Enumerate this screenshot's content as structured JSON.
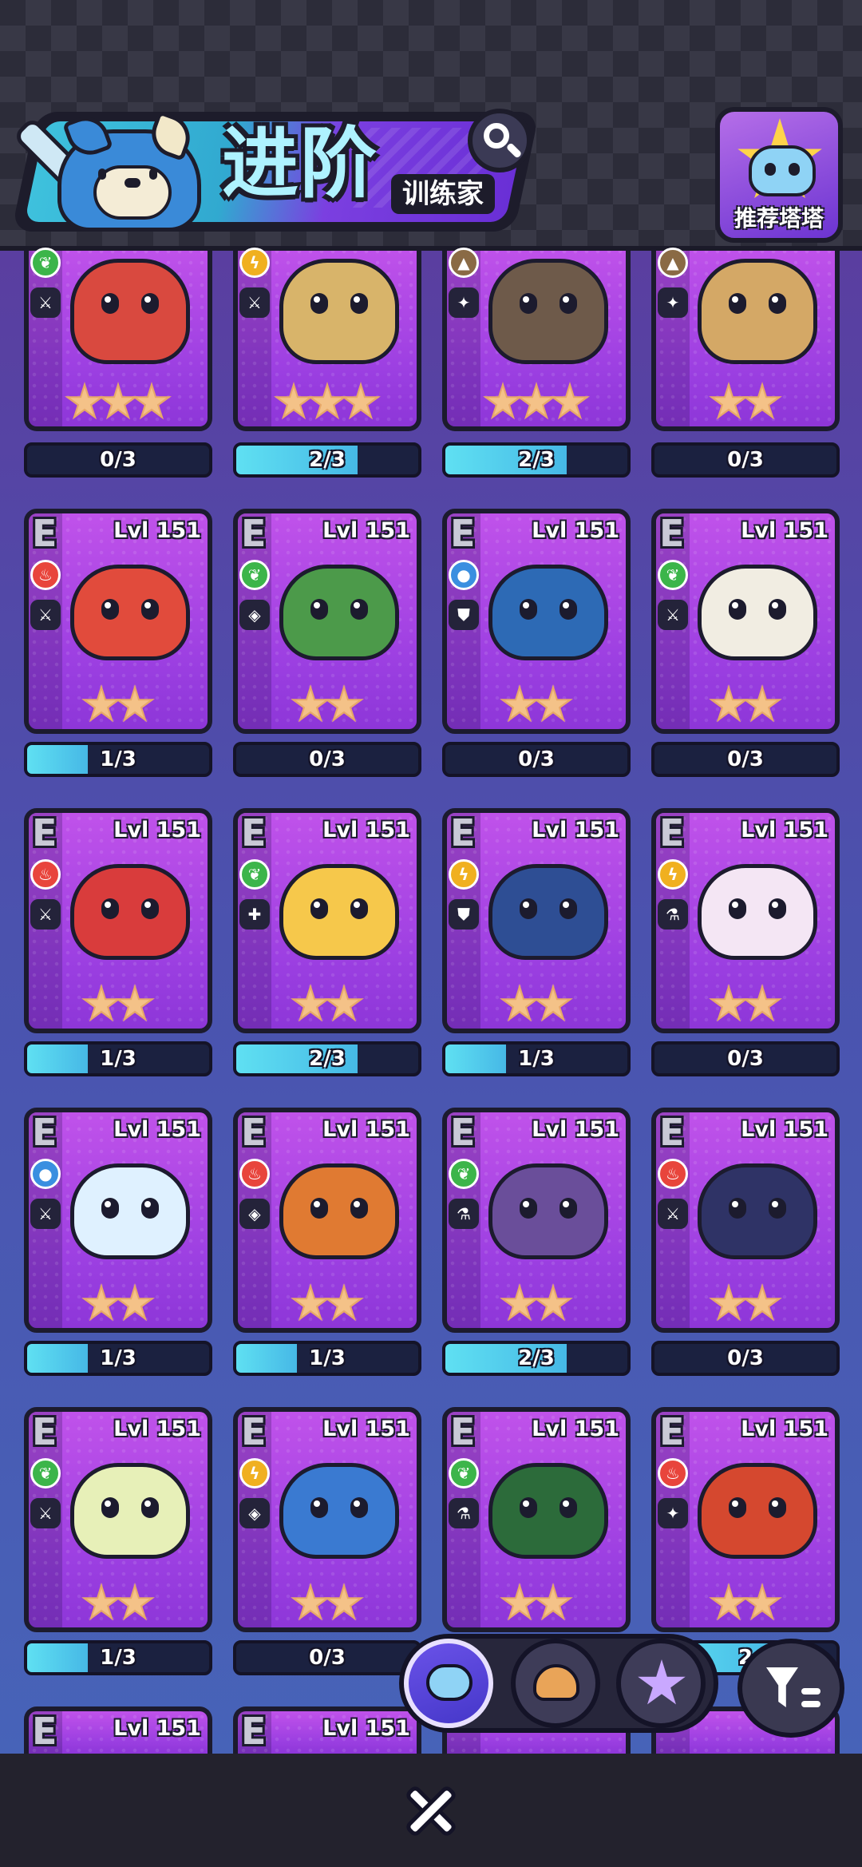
{
  "header": {
    "title": "进阶",
    "subtitle": "训练家",
    "recommend_label": "推荐塔塔"
  },
  "colors": {
    "grass": "#3cb54a",
    "fire": "#e8453c",
    "water": "#3a8fe0",
    "electric": "#f0b020",
    "earth": "#8a6a45",
    "card_purple": "#a845e4",
    "progress_cyan": "#52d2ef"
  },
  "cards": [
    {
      "tier": "",
      "level": "",
      "element": "grass",
      "role": "attack",
      "stars": 3,
      "creature": "red-sprout-bulb",
      "progress": "0/3",
      "filled": 0
    },
    {
      "tier": "",
      "level": "",
      "element": "electric",
      "role": "attack",
      "stars": 3,
      "creature": "lantern-monkey",
      "progress": "2/3",
      "filled": 2
    },
    {
      "tier": "",
      "level": "",
      "element": "earth",
      "role": "support",
      "stars": 3,
      "creature": "rock-lizard",
      "progress": "2/3",
      "filled": 2
    },
    {
      "tier": "",
      "level": "",
      "element": "earth",
      "role": "support",
      "stars": 2,
      "creature": "shell-turtle",
      "progress": "0/3",
      "filled": 0
    },
    {
      "tier": "E",
      "level": "Lvl 151",
      "element": "fire",
      "role": "attack",
      "stars": 2,
      "creature": "red-fox",
      "progress": "1/3",
      "filled": 1
    },
    {
      "tier": "E",
      "level": "Lvl 151",
      "element": "grass",
      "role": "utility",
      "stars": 2,
      "creature": "leaf-beetle",
      "progress": "0/3",
      "filled": 0
    },
    {
      "tier": "E",
      "level": "Lvl 151",
      "element": "water",
      "role": "defense",
      "stars": 2,
      "creature": "crested-penguin",
      "progress": "0/3",
      "filled": 0
    },
    {
      "tier": "E",
      "level": "Lvl 151",
      "element": "grass",
      "role": "attack",
      "stars": 2,
      "creature": "panda",
      "progress": "0/3",
      "filled": 0
    },
    {
      "tier": "E",
      "level": "Lvl 151",
      "element": "fire",
      "role": "attack",
      "stars": 2,
      "creature": "red-owl",
      "progress": "1/3",
      "filled": 1
    },
    {
      "tier": "E",
      "level": "Lvl 151",
      "element": "grass",
      "role": "heal",
      "stars": 2,
      "creature": "sunflower",
      "progress": "2/3",
      "filled": 2
    },
    {
      "tier": "E",
      "level": "Lvl 151",
      "element": "electric",
      "role": "defense",
      "stars": 2,
      "creature": "toucan",
      "progress": "1/3",
      "filled": 1
    },
    {
      "tier": "E",
      "level": "Lvl 151",
      "element": "electric",
      "role": "magic",
      "stars": 2,
      "creature": "star-bunny",
      "progress": "0/3",
      "filled": 0
    },
    {
      "tier": "E",
      "level": "Lvl 151",
      "element": "water",
      "role": "attack",
      "stars": 2,
      "creature": "jellyfish",
      "progress": "1/3",
      "filled": 1
    },
    {
      "tier": "E",
      "level": "Lvl 151",
      "element": "fire",
      "role": "utility",
      "stars": 2,
      "creature": "tiger",
      "progress": "1/3",
      "filled": 1
    },
    {
      "tier": "E",
      "level": "Lvl 151",
      "element": "grass",
      "role": "magic",
      "stars": 2,
      "creature": "mushroom",
      "progress": "2/3",
      "filled": 2
    },
    {
      "tier": "E",
      "level": "Lvl 151",
      "element": "fire",
      "role": "attack",
      "stars": 2,
      "creature": "fox-cat",
      "progress": "0/3",
      "filled": 0
    },
    {
      "tier": "E",
      "level": "Lvl 151",
      "element": "grass",
      "role": "attack",
      "stars": 2,
      "creature": "leaf-chick",
      "progress": "1/3",
      "filled": 1
    },
    {
      "tier": "E",
      "level": "Lvl 151",
      "element": "electric",
      "role": "utility",
      "stars": 2,
      "creature": "blue-bird",
      "progress": "0/3",
      "filled": 0
    },
    {
      "tier": "E",
      "level": "Lvl 151",
      "element": "grass",
      "role": "magic",
      "stars": 2,
      "creature": "green-owl",
      "progress": "",
      "filled": 0
    },
    {
      "tier": "E",
      "level": "Lvl 151",
      "element": "fire",
      "role": "support",
      "stars": 2,
      "creature": "goggle-bird",
      "progress": "2",
      "filled": 2
    },
    {
      "tier": "E",
      "level": "Lvl 151",
      "element": "",
      "role": "",
      "stars": 0,
      "creature": "",
      "progress": "",
      "filled": 0
    },
    {
      "tier": "E",
      "level": "Lvl 151",
      "element": "",
      "role": "",
      "stars": 0,
      "creature": "",
      "progress": "",
      "filled": 0
    },
    {
      "tier": "",
      "level": "",
      "element": "",
      "role": "",
      "stars": 0,
      "creature": "",
      "progress": "",
      "filled": 0
    },
    {
      "tier": "",
      "level": "",
      "element": "",
      "role": "",
      "stars": 0,
      "creature": "",
      "progress": "",
      "filled": 0
    }
  ],
  "filter_buttons": [
    {
      "name": "robot-cat-icon",
      "selected": true
    },
    {
      "name": "bread-icon",
      "selected": false
    },
    {
      "name": "gem-cat-icon",
      "selected": false
    }
  ]
}
